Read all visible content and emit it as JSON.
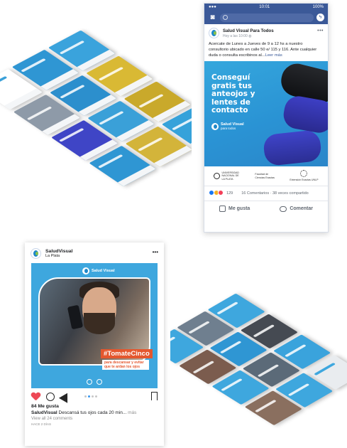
{
  "facebook": {
    "status": {
      "carrier": "●●● ",
      "time": "10:01",
      "battery": "100%"
    },
    "page_name": "Salud Visual Para Todos",
    "post_time": "Hoy a las 10:00",
    "post_text": "Acercate de Lunes a Jueves de 9 a 12 hs a nuestro consultorio ubicado en calle 50 e/ 115 y 116. Ante cualquier duda o consulta escribinos al...",
    "read_more": "Leer más",
    "photo_headline": "Conseguí gratis tus anteojos y lentes de contacto",
    "brand": {
      "name": "Salud Visual",
      "sub": "para todos"
    },
    "institutions": [
      {
        "label": "UNIVERSIDAD NACIONAL DE LA PLATA"
      },
      {
        "label": "Facultad de Ciencias Exactas"
      },
      {
        "label": "Extensión Exactas UNLP"
      }
    ],
    "reaction_count": "129",
    "comments_shares": "16 Comentarios · 38 veces compartido",
    "like_label": "Me gusta",
    "comment_label": "Comentar",
    "colors": {
      "brand": "#3b5998",
      "photo": "#2a93d4"
    }
  },
  "instagram": {
    "account": "SaludVisual",
    "location": "La Plata",
    "photo_brand": "Salud Visual",
    "hashtag": "#TomateCinco",
    "tag_sub": "para descansar y evitar que te ardan los ojos",
    "likes": "84 Me gusta",
    "caption_user": "SaludVisual",
    "caption_text": "Descansá tus ojos cada 20 min...",
    "caption_more": "más",
    "view_comments": "View all 24 comments",
    "time_ago": "hace 2 días",
    "colors": {
      "brand": "#3ea7de",
      "accent": "#e4572e"
    }
  }
}
